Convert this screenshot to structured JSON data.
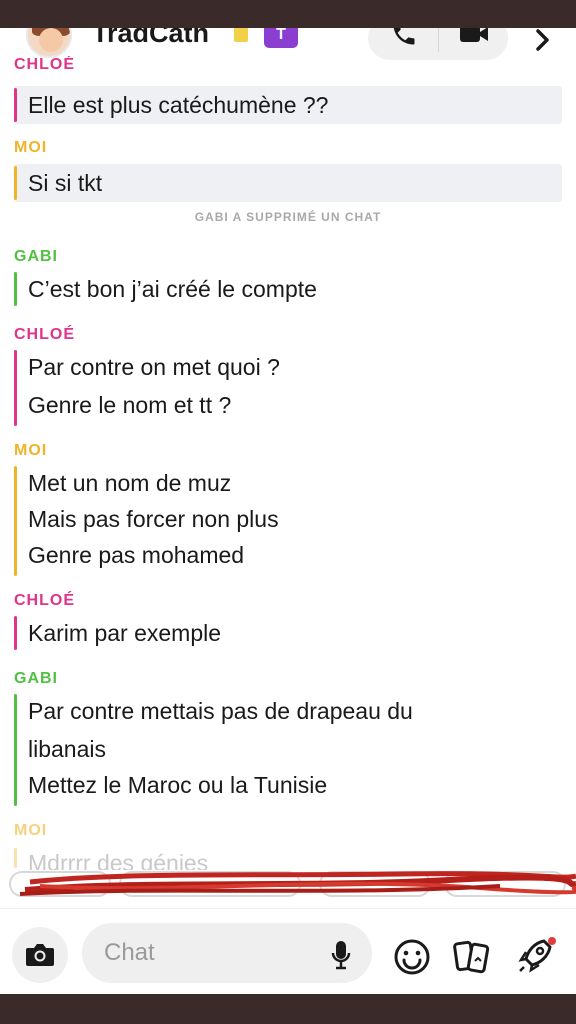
{
  "header": {
    "title": "TradCath",
    "badge": "T"
  },
  "messages": [
    {
      "sender": "CHLOÉ",
      "lines": [
        "Elle est plus catéchumène ??"
      ]
    },
    {
      "sender": "MOI",
      "lines": [
        "Si si tkt"
      ]
    },
    {
      "system": "GABI A SUPPRIMÉ UN CHAT"
    },
    {
      "sender": "GABI",
      "lines": [
        "C’est bon j’ai créé le compte"
      ]
    },
    {
      "sender": "CHLOÉ",
      "lines": [
        "Par contre on met quoi ?",
        "Genre le nom et tt ?"
      ]
    },
    {
      "sender": "MOI",
      "lines": [
        "Met un nom de muz",
        "Mais pas forcer non plus",
        "Genre pas mohamed"
      ]
    },
    {
      "sender": "CHLOÉ",
      "lines": [
        "Karim par exemple"
      ]
    },
    {
      "sender": "GABI",
      "lines": [
        "Par contre mettais pas de drapeau du",
        "libanais",
        "Mettez le Maroc ou la Tunisie"
      ]
    },
    {
      "sender": "MOI",
      "lines": [
        "Mdrrrr des génies"
      ]
    }
  ],
  "composer": {
    "placeholder": "Chat"
  },
  "colors": {
    "chloe": "#e0338a",
    "moi": "#f0b429",
    "gabi": "#52c043",
    "badge": "#8a3fd1"
  },
  "icons": [
    "camera-icon",
    "microphone-icon",
    "smiley-icon",
    "sticker-icon",
    "rocket-icon",
    "phone-icon",
    "video-icon",
    "chevron-right-icon"
  ]
}
